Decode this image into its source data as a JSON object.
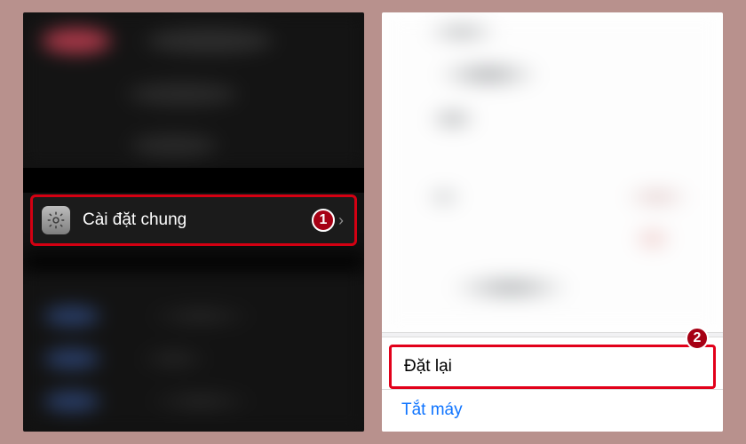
{
  "left": {
    "general_settings_label": "Cài đặt chung",
    "gear_icon": "gear-icon",
    "badge_number": "1"
  },
  "right": {
    "reset_label": "Đặt lại",
    "shutdown_label": "Tắt máy",
    "badge_number": "2"
  },
  "colors": {
    "highlight_border": "#e2001a",
    "badge_bg": "#a60014",
    "link_blue": "#0f74ff"
  }
}
